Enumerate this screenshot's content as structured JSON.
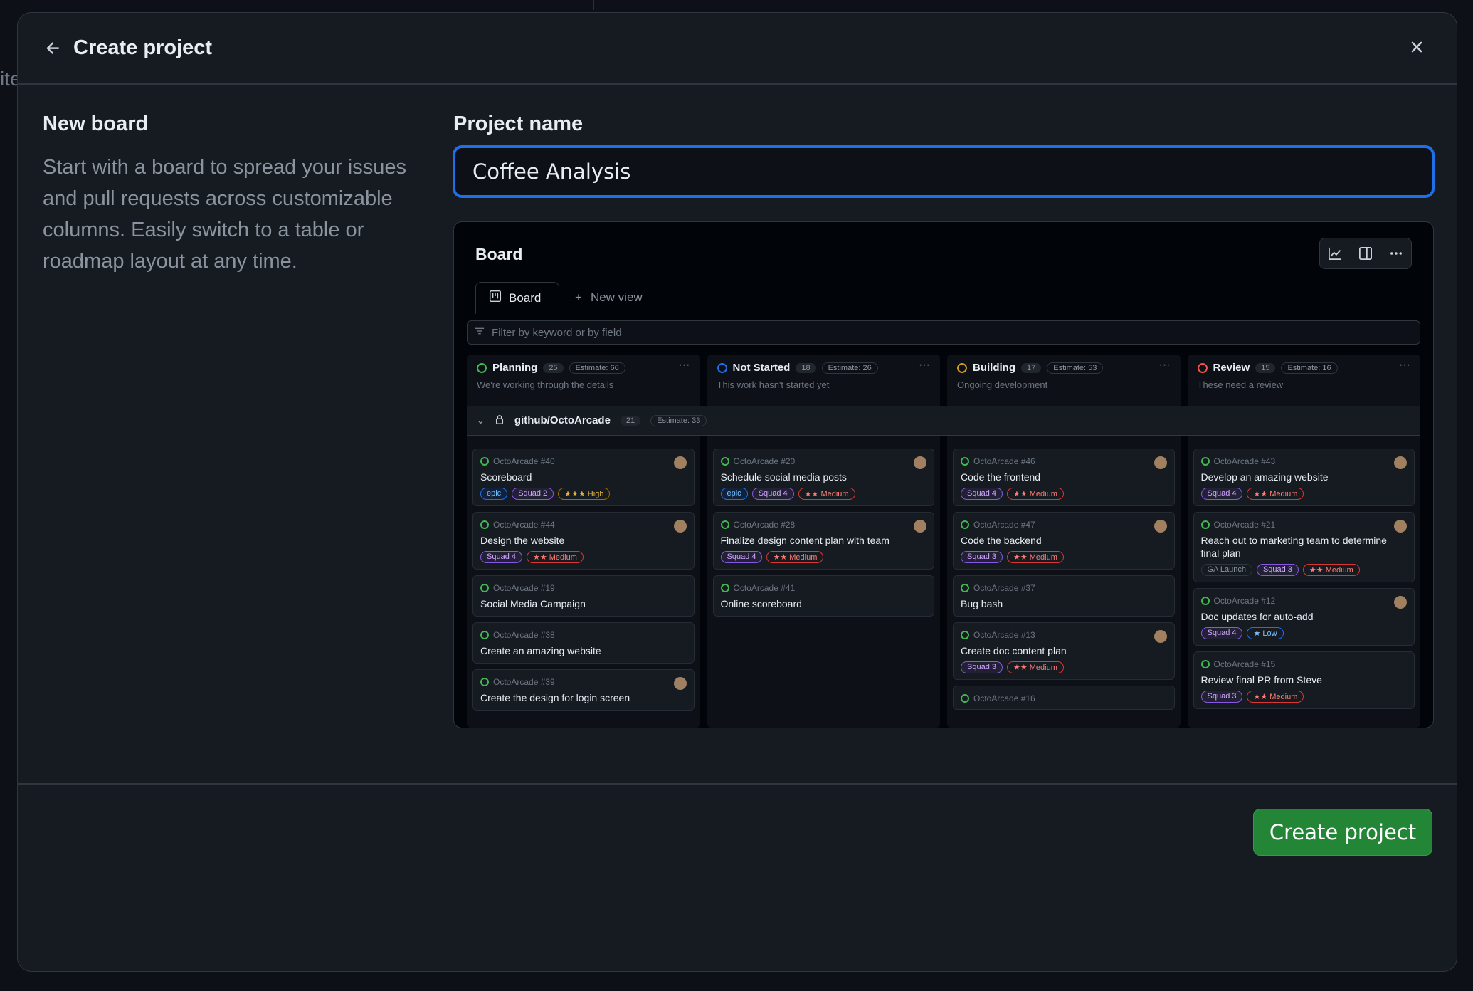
{
  "colors": {
    "accent": "#1f6feb",
    "primary_button": "#238636",
    "background": "#0d1117",
    "dialog": "#161b22"
  },
  "backdrop": {
    "edge_text": "ite"
  },
  "dialog": {
    "title": "Create project",
    "back_icon": "arrow-left-icon",
    "close_icon": "x-icon"
  },
  "template": {
    "name": "New board",
    "description": "Start with a board to spread your issues and pull requests across customizable columns. Easily switch to a table or roadmap layout at any time."
  },
  "form": {
    "project_name_label": "Project name",
    "project_name_value": "Coffee Analysis"
  },
  "preview": {
    "title": "Board",
    "tab_label": "Board",
    "new_view_label": "New view",
    "filter_placeholder": "Filter by keyword or by field",
    "group": {
      "name": "github/OctoArcade",
      "count": "21",
      "estimate": "Estimate: 33"
    },
    "columns": [
      {
        "name": "Planning",
        "count": "25",
        "estimate": "Estimate: 66",
        "desc": "We're working through the details",
        "color": "#3fb950",
        "cards": [
          {
            "ref": "OctoArcade #40",
            "title": "Scoreboard",
            "labels": [
              "epic",
              "Squad 2",
              "★★★ High"
            ]
          },
          {
            "ref": "OctoArcade #44",
            "title": "Design the website",
            "labels": [
              "Squad 4",
              "★★ Medium"
            ]
          },
          {
            "ref": "OctoArcade #19",
            "title": "Social Media Campaign",
            "labels": []
          },
          {
            "ref": "OctoArcade #38",
            "title": "Create an amazing website",
            "labels": []
          },
          {
            "ref": "OctoArcade #39",
            "title": "Create the design for login screen",
            "labels": []
          }
        ]
      },
      {
        "name": "Not Started",
        "count": "18",
        "estimate": "Estimate: 26",
        "desc": "This work hasn't started yet",
        "color": "#1f6feb",
        "cards": [
          {
            "ref": "OctoArcade #20",
            "title": "Schedule social media posts",
            "labels": [
              "epic",
              "Squad 4",
              "★★ Medium"
            ]
          },
          {
            "ref": "OctoArcade #28",
            "title": "Finalize design content plan with team",
            "labels": [
              "Squad 4",
              "★★ Medium"
            ]
          },
          {
            "ref": "OctoArcade #41",
            "title": "Online scoreboard",
            "labels": []
          }
        ]
      },
      {
        "name": "Building",
        "count": "17",
        "estimate": "Estimate: 53",
        "desc": "Ongoing development",
        "color": "#d29922",
        "cards": [
          {
            "ref": "OctoArcade #46",
            "title": "Code the frontend",
            "labels": [
              "Squad 4",
              "★★ Medium"
            ]
          },
          {
            "ref": "OctoArcade #47",
            "title": "Code the backend",
            "labels": [
              "Squad 3",
              "★★ Medium"
            ]
          },
          {
            "ref": "OctoArcade #37",
            "title": "Bug bash",
            "labels": []
          },
          {
            "ref": "OctoArcade #13",
            "title": "Create doc content plan",
            "labels": [
              "Squad 3",
              "★★ Medium"
            ]
          },
          {
            "ref": "OctoArcade #16",
            "title": "",
            "labels": []
          }
        ]
      },
      {
        "name": "Review",
        "count": "15",
        "estimate": "Estimate: 16",
        "desc": "These need a review",
        "color": "#f85149",
        "cards": [
          {
            "ref": "OctoArcade #43",
            "title": "Develop an amazing website",
            "labels": [
              "Squad 4",
              "★★ Medium"
            ]
          },
          {
            "ref": "OctoArcade #21",
            "title": "Reach out to marketing team to determine final plan",
            "labels": [
              "GA Launch",
              "Squad 3",
              "★★ Medium"
            ]
          },
          {
            "ref": "OctoArcade #12",
            "title": "Doc updates for auto-add",
            "labels": [
              "Squad 4",
              "★ Low"
            ]
          },
          {
            "ref": "OctoArcade #15",
            "title": "Review final PR from Steve",
            "labels": [
              "Squad 3",
              "★★ Medium"
            ]
          }
        ]
      }
    ]
  },
  "footer": {
    "create_button_label": "Create project"
  }
}
